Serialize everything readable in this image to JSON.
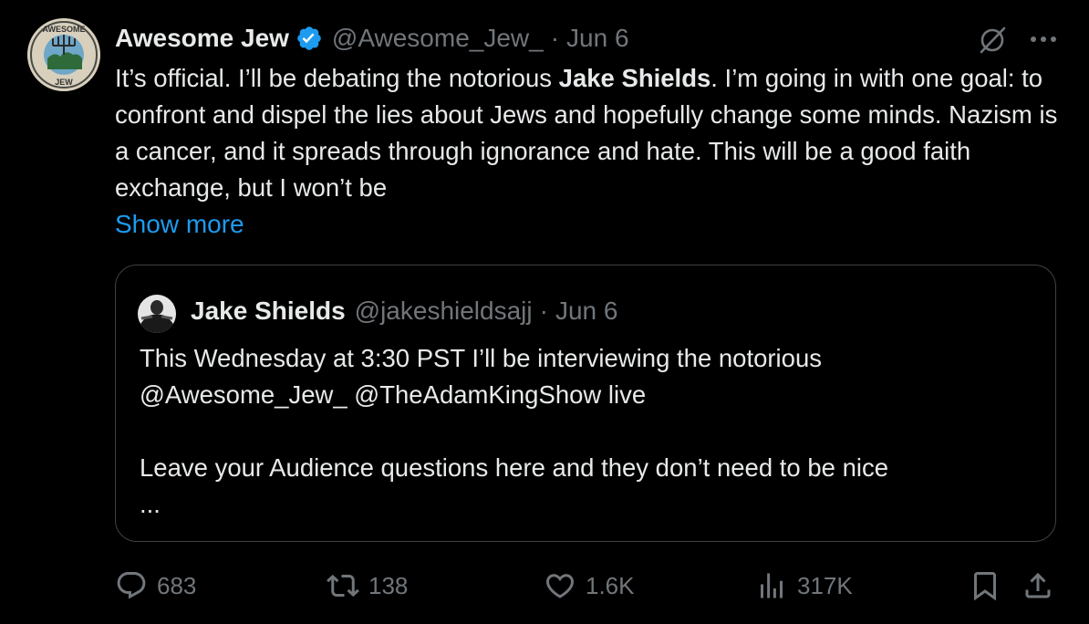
{
  "tweet": {
    "author": {
      "name": "Awesome Jew",
      "handle": "@Awesome_Jew_",
      "avatar_text_top": "AWESOME",
      "avatar_text_bottom": "JEW",
      "verified": true
    },
    "separator": "·",
    "date": "Jun 6",
    "text": {
      "part1": "It’s official. I’ll be debating the notorious ",
      "bold": "Jake Shields",
      "part2": ". I’m going in with one goal: to confront and dispel the lies about Jews and hopefully change some minds. Nazism is a cancer, and it spreads through ignorance and hate. This will be a good faith exchange, but I won’t be"
    },
    "show_more": "Show more",
    "quote": {
      "name": "Jake Shields",
      "handle": "@jakeshieldsajj",
      "separator": "·",
      "date": "Jun 6",
      "line1": "This Wednesday at 3:30 PST I’ll be interviewing the notorious",
      "line2": "@Awesome_Jew_ @TheAdamKingShow live",
      "line3": "Leave your Audience questions here and they don’t need to be nice",
      "ellipsis": "..."
    },
    "actions": {
      "replies": "683",
      "reposts": "138",
      "likes": "1.6K",
      "views": "317K"
    }
  },
  "colors": {
    "background": "#000000",
    "text": "#e7e9ea",
    "muted": "#71767b",
    "link": "#1d9bf0",
    "border": "#3e4144",
    "verified": "#1d9bf0"
  },
  "icons": {
    "verified": "verified-badge-icon",
    "grok": "grok-icon",
    "more": "more-icon",
    "reply": "reply-icon",
    "repost": "repost-icon",
    "like": "like-icon",
    "views": "views-icon",
    "bookmark": "bookmark-icon",
    "share": "share-icon"
  }
}
